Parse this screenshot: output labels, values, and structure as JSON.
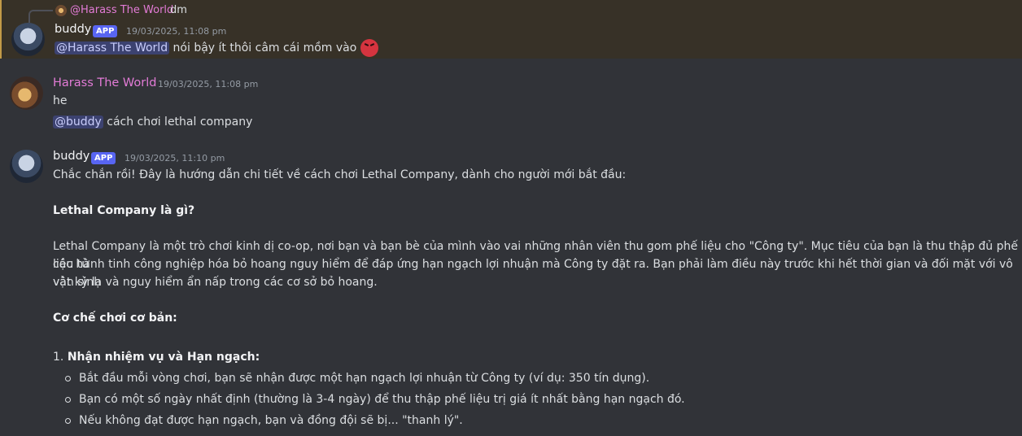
{
  "messages": [
    {
      "reply": {
        "author": "@Harass The World",
        "text": "dm"
      },
      "author": "buddy",
      "badge": "APP",
      "timestamp": "19/03/2025, 11:08 pm",
      "mention": "@Harass The World",
      "text": "nói bậy ít thôi câm cái mồm vào",
      "emoji": "angry-face-icon"
    },
    {
      "author": "Harass The World",
      "timestamp": "19/03/2025, 11:08 pm",
      "line1": "he",
      "mention": "@buddy",
      "line2": "cách chơi lethal company"
    },
    {
      "author": "buddy",
      "badge": "APP",
      "timestamp": "19/03/2025, 11:10 pm",
      "intro": "Chắc chắn rồi! Đây là hướng dẫn chi tiết về cách chơi Lethal Company, dành cho người mới bắt đầu:",
      "heading1": "Lethal Company là gì?",
      "para1_line1": "Lethal Company là một trò chơi kinh dị co-op, nơi bạn và bạn bè của mình vào vai những nhân viên thu gom phế liệu cho \"Công ty\". Mục tiêu của bạn là thu thập đủ phế liệu từ",
      "para1_line2": "các hành tinh công nghiệp hóa bỏ hoang nguy hiểm để đáp ứng hạn ngạch lợi nhuận mà Công ty đặt ra. Bạn phải làm điều này trước khi hết thời gian và đối mặt với vô vàn sinh",
      "para1_line3": "vật kỳ lạ và nguy hiểm ẩn nấp trong các cơ sở bỏ hoang.",
      "heading2": "Cơ chế chơi cơ bản:",
      "list_number": "1.",
      "list_title": "Nhận nhiệm vụ và Hạn ngạch:",
      "bullets": [
        "Bắt đầu mỗi vòng chơi, bạn sẽ nhận được một hạn ngạch lợi nhuận từ Công ty (ví dụ: 350 tín dụng).",
        "Bạn có một số ngày nhất định (thường là 3-4 ngày) để thu thập phế liệu trị giá ít nhất bằng hạn ngạch đó.",
        "Nếu không đạt được hạn ngạch, bạn và đồng đội sẽ bị... \"thanh lý\"."
      ]
    }
  ],
  "colors": {
    "background": "#313338",
    "highlight": "#373127",
    "app_badge": "#5865f2",
    "harass_name": "#e27bd6",
    "mention_bg": "#3c4270"
  }
}
